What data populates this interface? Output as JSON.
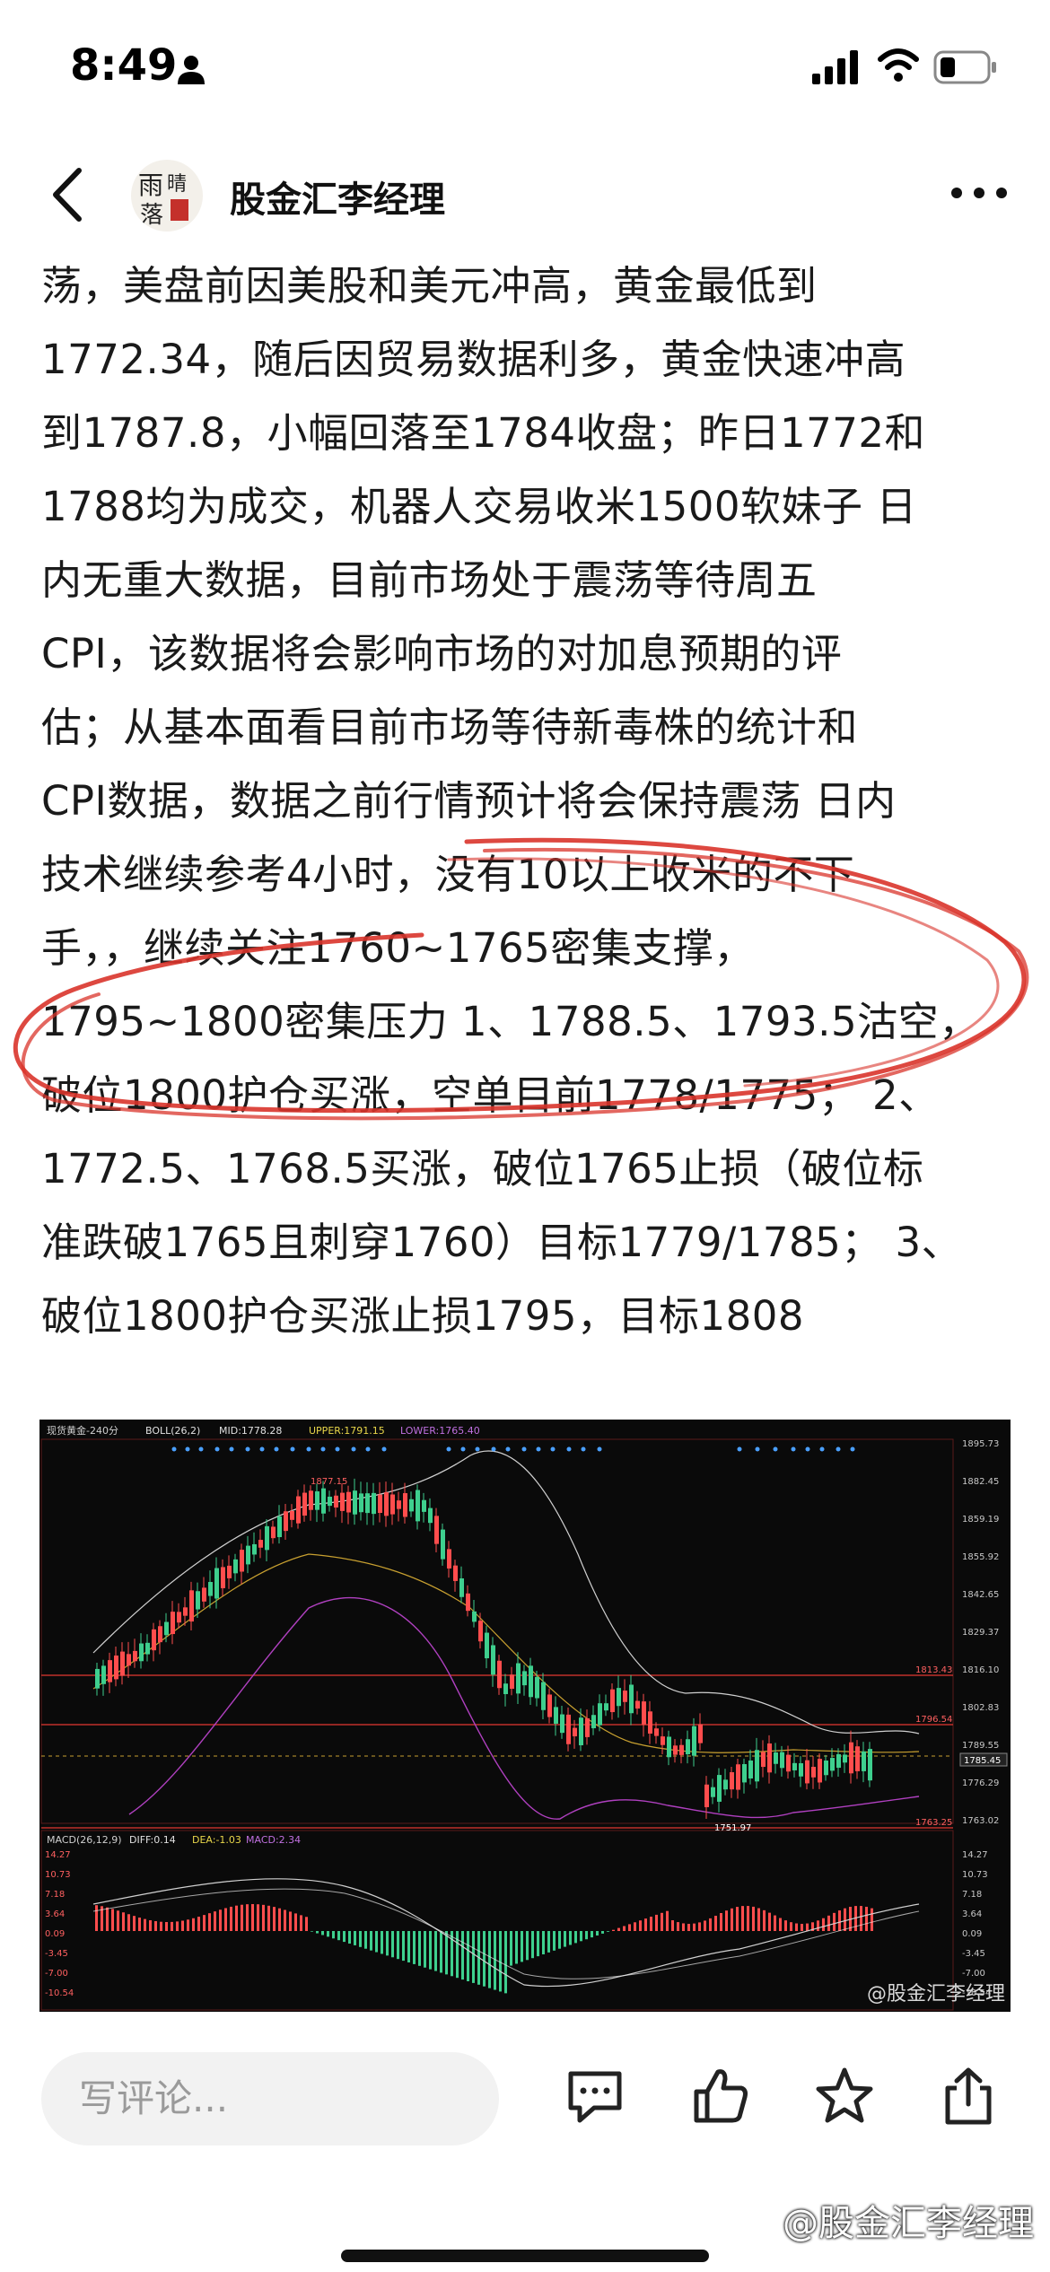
{
  "status": {
    "time": "8:49"
  },
  "header": {
    "author": "股金汇李经理",
    "avatar_text": "雨落"
  },
  "article": {
    "lines": [
      "荡，美盘前因美股和美元冲高，黄金最低到",
      "1772.34，随后因贸易数据利多，黄金快速冲高",
      "到1787.8，小幅回落至1784收盘；昨日1772和",
      "1788均为成交，机器人交易收米1500软妹子 日",
      "内无重大数据，目前市场处于震荡等待周五",
      "CPI，该数据将会影响市场的对加息预期的评",
      "估；从基本面看目前市场等待新毒株的统计和",
      "CPI数据，数据之前行情预计将会保持震荡 日内",
      "技术继续参考4小时，没有10以上收米的不下",
      "手，，继续关注1760~1765密集支撑，",
      "1795~1800密集压力 1、1788.5、1793.5沽空，",
      "破位1800护仓买涨，空单目前1778/1775； 2、",
      "1772.5、1768.5买涨，破位1765止损（破位标",
      "准跌破1765且刺穿1760）目标1779/1785； 3、",
      "破位1800护仓买涨止损1795，目标1808"
    ]
  },
  "chart": {
    "header_labels": [
      "现货黄金-240分",
      "BOLL(26,2)",
      "MID:1778.28",
      "UPPER:1791.15",
      "LOWER:1765.40"
    ],
    "y_ticks": [
      "1895.73",
      "1882.45",
      "1859.19",
      "1855.92",
      "1842.65",
      "1829.37",
      "1816.10",
      "1802.83",
      "1789.55",
      "1776.29",
      "1763.02"
    ],
    "price_labels": {
      "high": "1877.15",
      "low": "1751.97",
      "level_1": "1813.43",
      "level_2": "1796.54",
      "level_3": "1763.25",
      "current": "1785.45"
    },
    "macd_labels": [
      "MACD(26,12,9)",
      "DIFF:0.14",
      "DEA:-1.03",
      "MACD:2.34"
    ],
    "macd_ticks": [
      "14.27",
      "10.73",
      "7.18",
      "3.64",
      "0.09",
      "-3.45",
      "-7.00",
      "-10.54"
    ],
    "caption": "@股金汇李经理"
  },
  "bottom": {
    "comment_placeholder": "写评论...",
    "watermark": "@股金汇李经理",
    "icons": [
      "comment-icon",
      "like-icon",
      "star-icon",
      "share-icon"
    ]
  },
  "colors": {
    "scribble": "#d9342b",
    "candle_up": "#3ecf8e",
    "candle_down": "#ff4d4d",
    "boll": "#cfcfcf",
    "boll_lower": "#b040c0"
  }
}
